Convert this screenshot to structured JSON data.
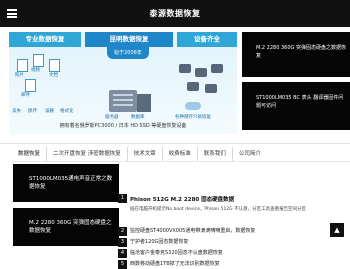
{
  "header": {
    "title": "泰源数据恢复"
  },
  "banner": {
    "sections": [
      "专业数据恢复",
      "昆明数据恢复",
      "设备齐全"
    ],
    "since": "始于2008年",
    "left_labels": [
      "照片",
      "视频",
      "文档",
      "邮件",
      "丢失",
      "损坏",
      "误删",
      "格式化"
    ],
    "center_labels": [
      "服务器",
      "数据库"
    ],
    "right_label": "各种储存介质恢复",
    "footer": "拥有着名俄罗斯PC3000 / 日本 HD SSD 等硬盘恢复设备"
  },
  "side_cards": [
    {
      "text": "M.2 2280 360G 突弹固态硬盘之数据恢复"
    },
    {
      "text": "ST1000LM035 BC 表头 翻译器固件问题可访问"
    }
  ],
  "tabs": [
    "数据恢复",
    "二次开盘恢复 涉密数据恢复",
    "技术文章",
    "收费标准",
    "联系我们",
    "公司简介"
  ],
  "left_cards": [
    {
      "text": "ST1000LM035通电声音正常之数据恢复"
    },
    {
      "text": "M.2 2280 360G 突弹固态硬盘之数据恢复"
    }
  ],
  "featured": {
    "number": "1",
    "title": "Phison 512G M.2 2280 固态硬盘数据",
    "desc": "插在电脑开机提示No boot device，Phison 512G 不认盘，分区工具查看报告空间分区"
  },
  "list": [
    {
      "num": "2",
      "text": "监控硬盘ST4000VX005通电带滴滴嘀嘀重启，数据恢复"
    },
    {
      "num": "3",
      "text": "宁护者120G固态数据恢复"
    },
    {
      "num": "4",
      "text": "临沧客户金泰克S320固态不认盘数据恢复"
    },
    {
      "num": "5",
      "text": "西数移动硬盘1TB掉了无法识别数据恢复"
    }
  ],
  "up_button": "▲"
}
